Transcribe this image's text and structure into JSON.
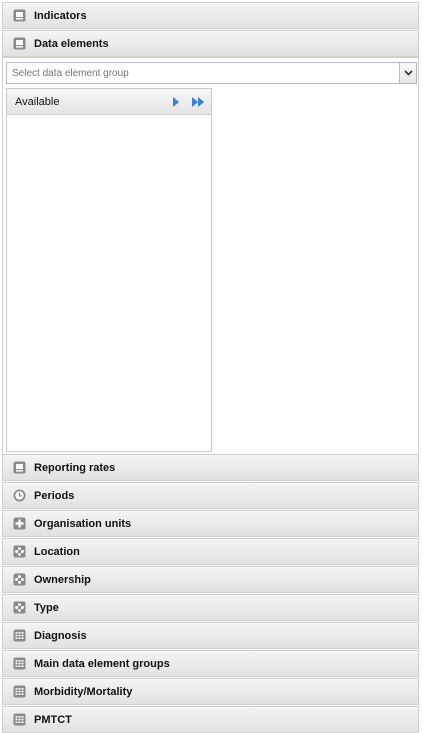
{
  "accordion": {
    "indicators": "Indicators",
    "data_elements": "Data elements",
    "reporting_rates": "Reporting rates",
    "periods": "Periods",
    "organisation_units": "Organisation units",
    "location": "Location",
    "ownership": "Ownership",
    "type": "Type",
    "diagnosis": "Diagnosis",
    "main_data_element_groups": "Main data element groups",
    "morbidity_mortality": "Morbidity/Mortality",
    "pmtct": "PMTCT"
  },
  "data_elements_panel": {
    "group_select_placeholder": "Select data element group",
    "available_title": "Available"
  },
  "icons": {
    "indicators": "monitor-icon",
    "data_elements": "monitor-icon",
    "reporting_rates": "monitor-icon",
    "periods": "clock-icon",
    "organisation_units": "plus-icon",
    "groupsets": "cluster-icon",
    "grids": "grid-icon",
    "select_one": "arrow-right-icon",
    "select_all": "double-arrow-right-icon",
    "combo_trigger": "chevron-down-icon"
  },
  "colors": {
    "header_bg": "#e8e8e8",
    "icon_bg": "#8a8a8a",
    "arrow_blue": "#3b7dd8"
  }
}
